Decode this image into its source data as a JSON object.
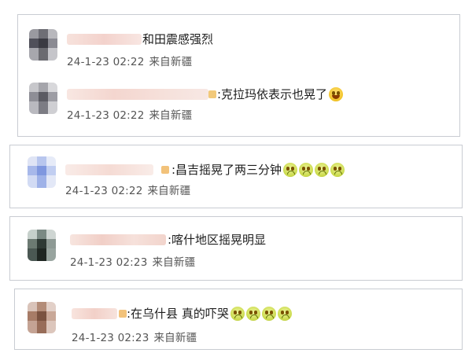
{
  "comments": [
    {
      "text": "和田震感强烈",
      "time": "24-1-23 02:22",
      "source": "来自新疆",
      "emojis": []
    },
    {
      "text": ":克拉玛依表示也晃了",
      "time": "24-1-23 02:22",
      "source": "来自新疆",
      "emojis": [
        "laugh"
      ]
    },
    {
      "text": ":昌吉摇晃了两三分钟",
      "time": "24-1-23 02:22",
      "source": "来自新疆",
      "emojis": [
        "cry",
        "cry",
        "cry",
        "cry"
      ]
    },
    {
      "text": ":喀什地区摇晃明显",
      "time": "24-1-23 02:23",
      "source": "来自新疆",
      "emojis": []
    },
    {
      "text": ":在乌什县 真的吓哭",
      "time": "24-1-23 02:23",
      "source": "来自新疆",
      "emojis": [
        "cry",
        "cry",
        "cry",
        "cry"
      ]
    }
  ]
}
